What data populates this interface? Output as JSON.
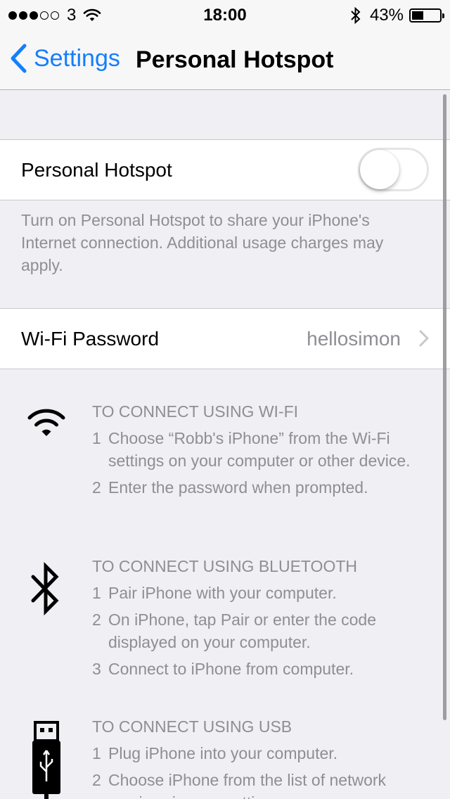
{
  "status_bar": {
    "signal_dots": [
      true,
      true,
      true,
      false,
      false
    ],
    "carrier": "3",
    "time": "18:00",
    "battery_percent": "43%",
    "battery_level": 0.43,
    "icons": [
      "wifi-icon",
      "bluetooth-icon",
      "battery-icon"
    ]
  },
  "nav": {
    "back_label": "Settings",
    "title": "Personal Hotspot"
  },
  "hotspot_row": {
    "label": "Personal Hotspot",
    "enabled": false
  },
  "hotspot_footnote": "Turn on Personal Hotspot to share your iPhone's Internet connection. Additional usage charges may apply.",
  "password_row": {
    "label": "Wi-Fi Password",
    "value": "hellosimon"
  },
  "instructions": [
    {
      "icon": "wifi-icon",
      "heading": "TO CONNECT USING WI-FI",
      "steps": [
        {
          "num": "1",
          "text": "Choose “Robb's iPhone” from the Wi-Fi settings on your computer or other device."
        },
        {
          "num": "2",
          "text": "Enter the password when prompted."
        }
      ]
    },
    {
      "icon": "bluetooth-icon",
      "heading": "TO CONNECT USING BLUETOOTH",
      "steps": [
        {
          "num": "1",
          "text": "Pair iPhone with your computer."
        },
        {
          "num": "2",
          "text": "On iPhone, tap Pair or enter the code displayed on your computer."
        },
        {
          "num": "3",
          "text": "Connect to iPhone from computer."
        }
      ]
    },
    {
      "icon": "usb-icon",
      "heading": "TO CONNECT USING USB",
      "steps": [
        {
          "num": "1",
          "text": "Plug iPhone into your computer."
        },
        {
          "num": "2",
          "text": "Choose iPhone from the list of network services in your settings."
        }
      ]
    }
  ],
  "colors": {
    "accent": "#157efb",
    "background": "#efeff4",
    "secondary_text": "#8e8e93"
  }
}
